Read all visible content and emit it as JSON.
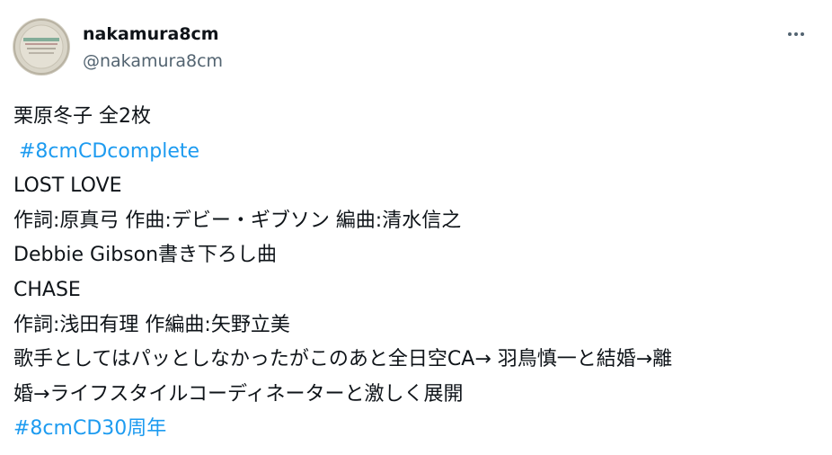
{
  "user": {
    "display_name": "nakamura8cm",
    "handle": "@nakamura8cm"
  },
  "icons": {
    "avatar": "profile-avatar-cd-icon",
    "more": "more-horizontal-icon"
  },
  "colors": {
    "text": "#0f1419",
    "secondary_text": "#536471",
    "link": "#1d9bf0"
  },
  "tweet": {
    "lines": [
      "栗原冬子 全2枚",
      "#8cmCDcomplete",
      "LOST LOVE",
      "作詞:原真弓 作曲:デビー・ギブソン 編曲:清水信之",
      "Debbie Gibson書き下ろし曲",
      "CHASE",
      "作詞:浅田有理 作編曲:矢野立美",
      "歌手としてはパッとしなかったがこのあと全日空CA→ 羽鳥慎一と結婚→離",
      "婚→ライフスタイルコーディネーターと激しく展開",
      "#8cmCD30周年"
    ]
  }
}
